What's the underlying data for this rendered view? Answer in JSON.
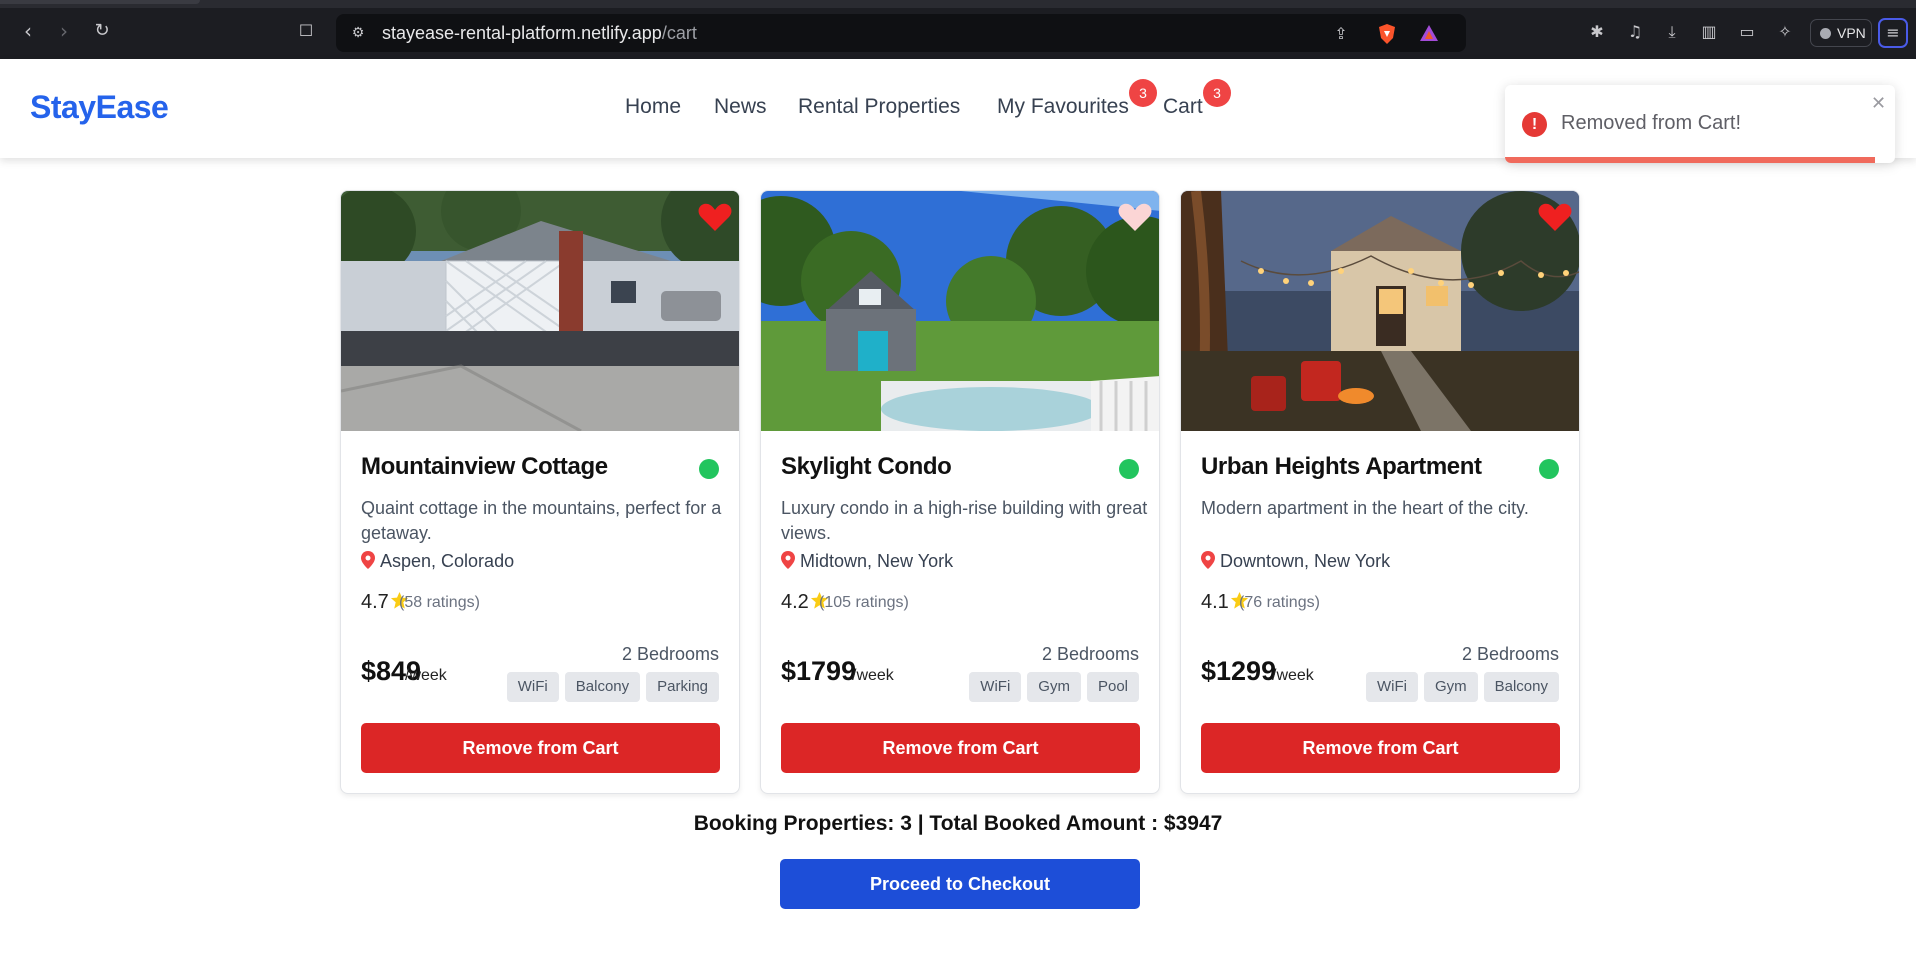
{
  "browser": {
    "url_host": "stayease-rental-platform.netlify.app",
    "url_path": "/cart",
    "vpn_label": "VPN"
  },
  "header": {
    "logo": "StayEase",
    "nav": [
      {
        "label": "Home"
      },
      {
        "label": "News"
      },
      {
        "label": "Rental Properties"
      },
      {
        "label": "My Favourites",
        "badge": "3"
      },
      {
        "label": "Cart",
        "badge": "3"
      }
    ]
  },
  "toast": {
    "message": "Removed from Cart!",
    "icon": "alert-icon",
    "color": "#e53935"
  },
  "cards": [
    {
      "title": "Mountainview Cottage",
      "description": "Quaint cottage in the mountains, perfect for a getaway.",
      "location": "Aspen, Colorado",
      "rating": "4.7",
      "ratings_count": "(58 ratings)",
      "price": "$849",
      "price_unit": "/week",
      "bedrooms": "2 Bedrooms",
      "amenities": [
        "WiFi",
        "Balcony",
        "Parking"
      ],
      "favourite": true,
      "button": "Remove from Cart"
    },
    {
      "title": "Skylight Condo",
      "description": "Luxury condo in a high-rise building with great views.",
      "location": "Midtown, New York",
      "rating": "4.2",
      "ratings_count": "(105 ratings)",
      "price": "$1799",
      "price_unit": "/week",
      "bedrooms": "2 Bedrooms",
      "amenities": [
        "WiFi",
        "Gym",
        "Pool"
      ],
      "favourite": false,
      "button": "Remove from Cart"
    },
    {
      "title": "Urban Heights Apartment",
      "description": "Modern apartment in the heart of the city.",
      "location": "Downtown, New York",
      "rating": "4.1",
      "ratings_count": "(76 ratings)",
      "price": "$1299",
      "price_unit": "/week",
      "bedrooms": "2 Bedrooms",
      "amenities": [
        "WiFi",
        "Gym",
        "Balcony"
      ],
      "favourite": true,
      "button": "Remove from Cart"
    }
  ],
  "summary": "Booking Properties: 3 | Total Booked Amount : $3947",
  "checkout_label": "Proceed to Checkout",
  "colors": {
    "brand": "#2563eb",
    "danger": "#dc2626",
    "primary_button": "#1d4ed8",
    "available": "#22c55e",
    "badge": "#ef4444"
  }
}
